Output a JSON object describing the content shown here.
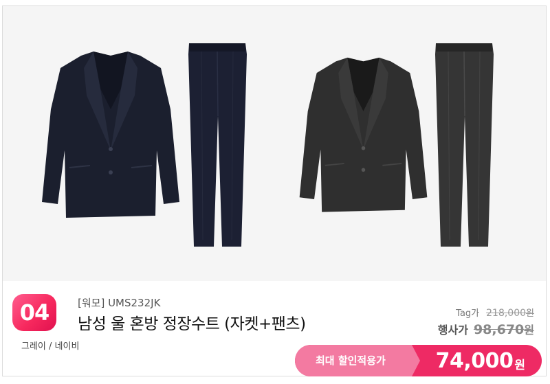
{
  "product": {
    "rank": "04",
    "brand_code": "[워모] UMS232JK",
    "name": "남성 울 혼방 정장수트 (자켓+팬츠)",
    "colors": "그레이 / 네이비"
  },
  "pricing": {
    "tag_label": "Tag가",
    "tag_price": "218,000",
    "event_label": "행사가",
    "event_price": "98,670",
    "currency": "원",
    "discount_label": "최대 할인적용가",
    "discount_price": "74,000"
  },
  "colors": {
    "accent": "#ee2a64",
    "accent_light": "#f37aa1",
    "navy_suit": "#1b1f2e",
    "gray_suit": "#2f2f2f"
  },
  "images": [
    {
      "name": "navy-suit-jacket-icon"
    },
    {
      "name": "navy-suit-pants-icon"
    },
    {
      "name": "gray-suit-jacket-icon"
    },
    {
      "name": "gray-suit-pants-icon"
    }
  ]
}
